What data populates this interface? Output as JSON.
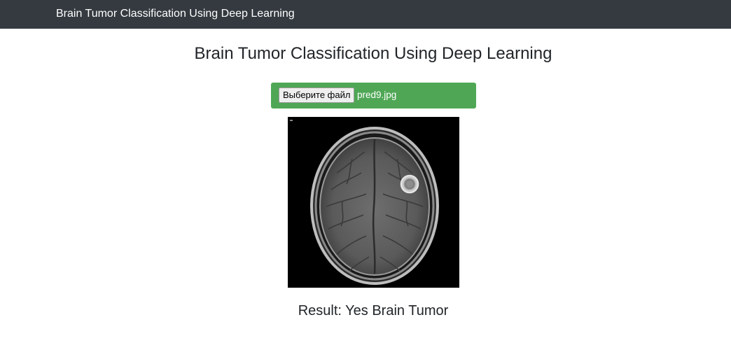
{
  "navbar": {
    "brand": "Brain Tumor Classification Using Deep Learning"
  },
  "main": {
    "title": "Brain Tumor Classification Using Deep Learning",
    "upload": {
      "button_label": "Выберите файл",
      "file_name": "pred9.jpg"
    },
    "result": "Result: Yes Brain Tumor"
  },
  "colors": {
    "navbar_bg": "#343a40",
    "upload_bg": "#4fa755"
  }
}
